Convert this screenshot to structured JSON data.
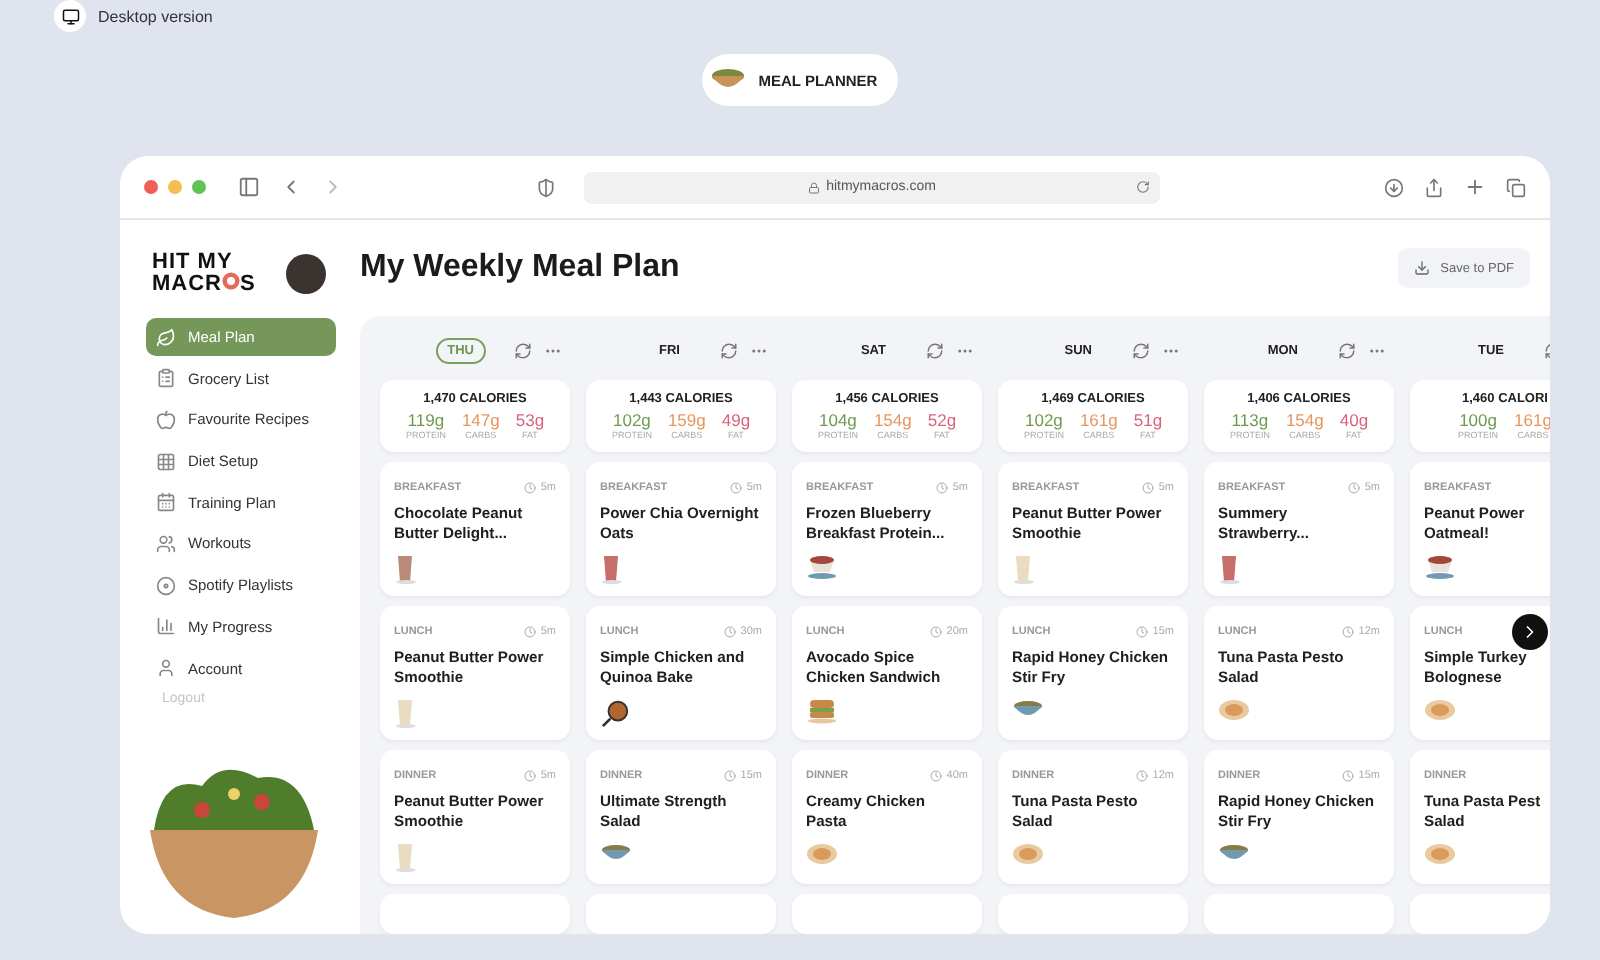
{
  "top_bar": {
    "label": "Desktop version"
  },
  "badge": {
    "label": "MEAL PLANNER"
  },
  "browser": {
    "url": "hitmymacros.com"
  },
  "logo": {
    "line1": "HIT MY",
    "line2_start": "MACR",
    "line2_end": "S"
  },
  "sidebar": {
    "items": [
      {
        "label": "Meal Plan",
        "selected": true
      },
      {
        "label": "Grocery List",
        "selected": false
      },
      {
        "label": "Favourite Recipes",
        "selected": false
      },
      {
        "label": "Diet Setup",
        "selected": false
      },
      {
        "label": "Training Plan",
        "selected": false
      },
      {
        "label": "Workouts",
        "selected": false
      },
      {
        "label": "Spotify Playlists",
        "selected": false
      },
      {
        "label": "My Progress",
        "selected": false
      },
      {
        "label": "Account",
        "selected": false
      }
    ],
    "logout": "Logout"
  },
  "page_title": "My Weekly Meal Plan",
  "save_button": "Save to PDF",
  "days": [
    {
      "label": "THU",
      "selected": true,
      "calories": "1,470 CALORIES",
      "macros": [
        {
          "kind": "protein",
          "value": "119g",
          "label": "PROTEIN"
        },
        {
          "kind": "carbs",
          "value": "147g",
          "label": "CARBS"
        },
        {
          "kind": "fat",
          "value": "53g",
          "label": "FAT"
        }
      ],
      "meals": [
        {
          "type": "BREAKFAST",
          "time": "5m",
          "title": "Chocolate Peanut Butter Delight...",
          "kind": "cocoa"
        },
        {
          "type": "LUNCH",
          "time": "5m",
          "title": "Peanut Butter Power Smoothie",
          "kind": "vanilla"
        },
        {
          "type": "DINNER",
          "time": "5m",
          "title": "Peanut Butter Power Smoothie",
          "kind": "vanilla"
        }
      ]
    },
    {
      "label": "FRI",
      "selected": false,
      "calories": "1,443 CALORIES",
      "macros": [
        {
          "kind": "protein",
          "value": "102g",
          "label": "PROTEIN"
        },
        {
          "kind": "carbs",
          "value": "159g",
          "label": "CARBS"
        },
        {
          "kind": "fat",
          "value": "49g",
          "label": "FAT"
        }
      ],
      "meals": [
        {
          "type": "BREAKFAST",
          "time": "5m",
          "title": "Power Chia Overnight Oats",
          "kind": "berry"
        },
        {
          "type": "LUNCH",
          "time": "30m",
          "title": "Simple Chicken and Quinoa Bake",
          "kind": "skillet"
        },
        {
          "type": "DINNER",
          "time": "15m",
          "title": "Ultimate Strength Salad",
          "kind": "bowl"
        }
      ]
    },
    {
      "label": "SAT",
      "selected": false,
      "calories": "1,456 CALORIES",
      "macros": [
        {
          "kind": "protein",
          "value": "104g",
          "label": "PROTEIN"
        },
        {
          "kind": "carbs",
          "value": "154g",
          "label": "CARBS"
        },
        {
          "kind": "fat",
          "value": "52g",
          "label": "FAT"
        }
      ],
      "meals": [
        {
          "type": "BREAKFAST",
          "time": "5m",
          "title": "Frozen Blueberry Breakfast Protein...",
          "kind": "cup"
        },
        {
          "type": "LUNCH",
          "time": "20m",
          "title": "Avocado Spice Chicken Sandwich",
          "kind": "sandwich"
        },
        {
          "type": "DINNER",
          "time": "40m",
          "title": "Creamy Chicken Pasta",
          "kind": "plate"
        }
      ]
    },
    {
      "label": "SUN",
      "selected": false,
      "calories": "1,469 CALORIES",
      "macros": [
        {
          "kind": "protein",
          "value": "102g",
          "label": "PROTEIN"
        },
        {
          "kind": "carbs",
          "value": "161g",
          "label": "CARBS"
        },
        {
          "kind": "fat",
          "value": "51g",
          "label": "FAT"
        }
      ],
      "meals": [
        {
          "type": "BREAKFAST",
          "time": "5m",
          "title": "Peanut Butter Power Smoothie",
          "kind": "vanilla"
        },
        {
          "type": "LUNCH",
          "time": "15m",
          "title": "Rapid Honey Chicken Stir Fry",
          "kind": "bowl"
        },
        {
          "type": "DINNER",
          "time": "12m",
          "title": "Tuna Pasta Pesto Salad",
          "kind": "plate"
        }
      ]
    },
    {
      "label": "MON",
      "selected": false,
      "calories": "1,406 CALORIES",
      "macros": [
        {
          "kind": "protein",
          "value": "113g",
          "label": "PROTEIN"
        },
        {
          "kind": "carbs",
          "value": "154g",
          "label": "CARBS"
        },
        {
          "kind": "fat",
          "value": "40g",
          "label": "FAT"
        }
      ],
      "meals": [
        {
          "type": "BREAKFAST",
          "time": "5m",
          "title": "Summery Strawberry...",
          "kind": "berry"
        },
        {
          "type": "LUNCH",
          "time": "12m",
          "title": "Tuna Pasta Pesto Salad",
          "kind": "plate"
        },
        {
          "type": "DINNER",
          "time": "15m",
          "title": "Rapid Honey Chicken Stir Fry",
          "kind": "bowl"
        }
      ]
    },
    {
      "label": "TUE",
      "selected": false,
      "calories": "1,460 CALORI",
      "macros": [
        {
          "kind": "protein",
          "value": "100g",
          "label": "PROTEIN"
        },
        {
          "kind": "carbs",
          "value": "161g",
          "label": "CARBS"
        }
      ],
      "meals": [
        {
          "type": "BREAKFAST",
          "title": "Peanut Power Oatmeal!",
          "kind": "cup"
        },
        {
          "type": "LUNCH",
          "title": "Simple Turkey Bolognese",
          "kind": "plate"
        },
        {
          "type": "DINNER",
          "title": "Tuna Pasta Pest\nSalad",
          "kind": "plate"
        }
      ]
    }
  ]
}
